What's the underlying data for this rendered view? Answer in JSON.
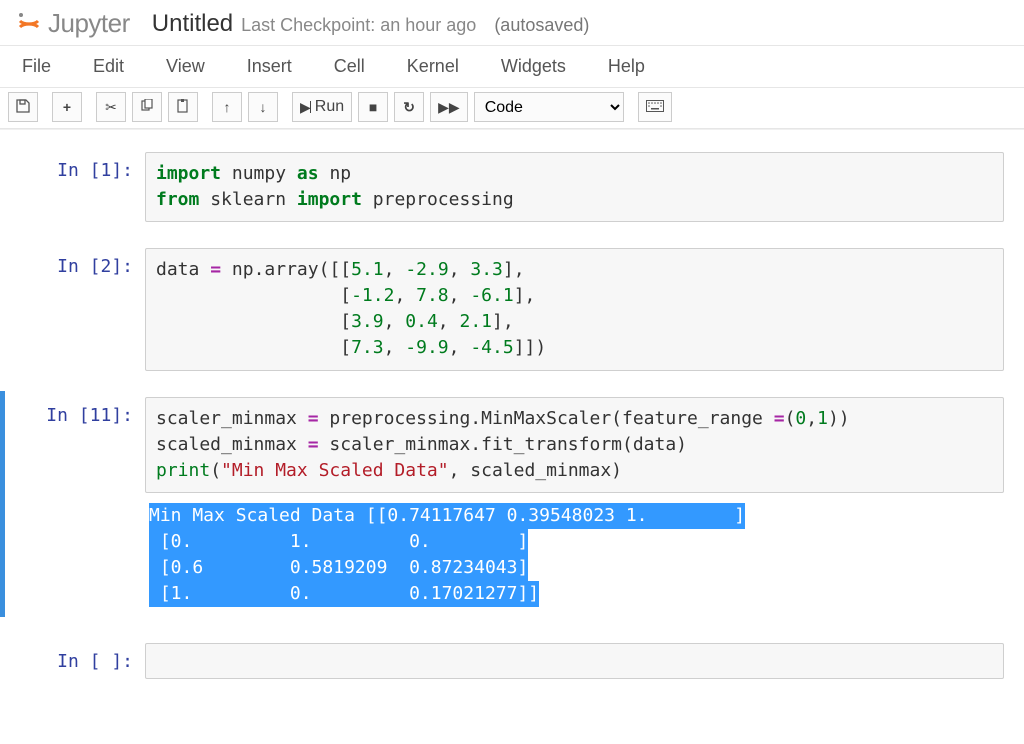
{
  "header": {
    "logo_text": "Jupyter",
    "doc_title": "Untitled",
    "checkpoint": "Last Checkpoint: an hour ago",
    "autosave": "(autosaved)"
  },
  "menubar": {
    "file": "File",
    "edit": "Edit",
    "view": "View",
    "insert": "Insert",
    "cell": "Cell",
    "kernel": "Kernel",
    "widgets": "Widgets",
    "help": "Help"
  },
  "toolbar": {
    "run_label": "Run",
    "cell_type": "Code"
  },
  "cells": {
    "c1": {
      "prompt": "In [1]:",
      "tok": {
        "import1": "import",
        "numpy": "numpy",
        "as1": "as",
        "np": "np",
        "from": "from",
        "sklearn": "sklearn",
        "import2": "import",
        "preprocessing": "preprocessing"
      }
    },
    "c2": {
      "prompt": "In [2]:",
      "tok": {
        "data": "data",
        "eq": "=",
        "np": "np",
        "dot": ".",
        "array": "array",
        "n1": "5.1",
        "n2": "-2.9",
        "n3": "3.3",
        "n4": "-1.2",
        "n5": "7.8",
        "n6": "-6.1",
        "n7": "3.9",
        "n8": "0.4",
        "n9": "2.1",
        "n10": "7.3",
        "n11": "-9.9",
        "n12": "-4.5"
      }
    },
    "c3": {
      "prompt": "In [11]:",
      "tok": {
        "l1a": "scaler_minmax ",
        "eq": "=",
        "l1b": " preprocessing.MinMaxScaler(feature_range ",
        "eq2": "=",
        "l1c": "(",
        "z0": "0",
        "com": ",",
        "z1": "1",
        "l1d": "))",
        "l2a": "scaled_minmax ",
        "eq3": "=",
        "l2b": " scaler_minmax.fit_transform(data)",
        "l3a": "print",
        "l3b": "(",
        "str": "\"Min Max Scaled Data\"",
        "l3c": ", scaled_minmax)"
      },
      "output": {
        "l1": "Min Max Scaled Data [[0.74117647 0.39548023 1.        ]",
        "l2": " [0.         1.         0.        ]",
        "l3": " [0.6        0.5819209  0.87234043]",
        "l4": " [1.         0.         0.17021277]]"
      }
    },
    "c4": {
      "prompt": "In [ ]:"
    }
  }
}
